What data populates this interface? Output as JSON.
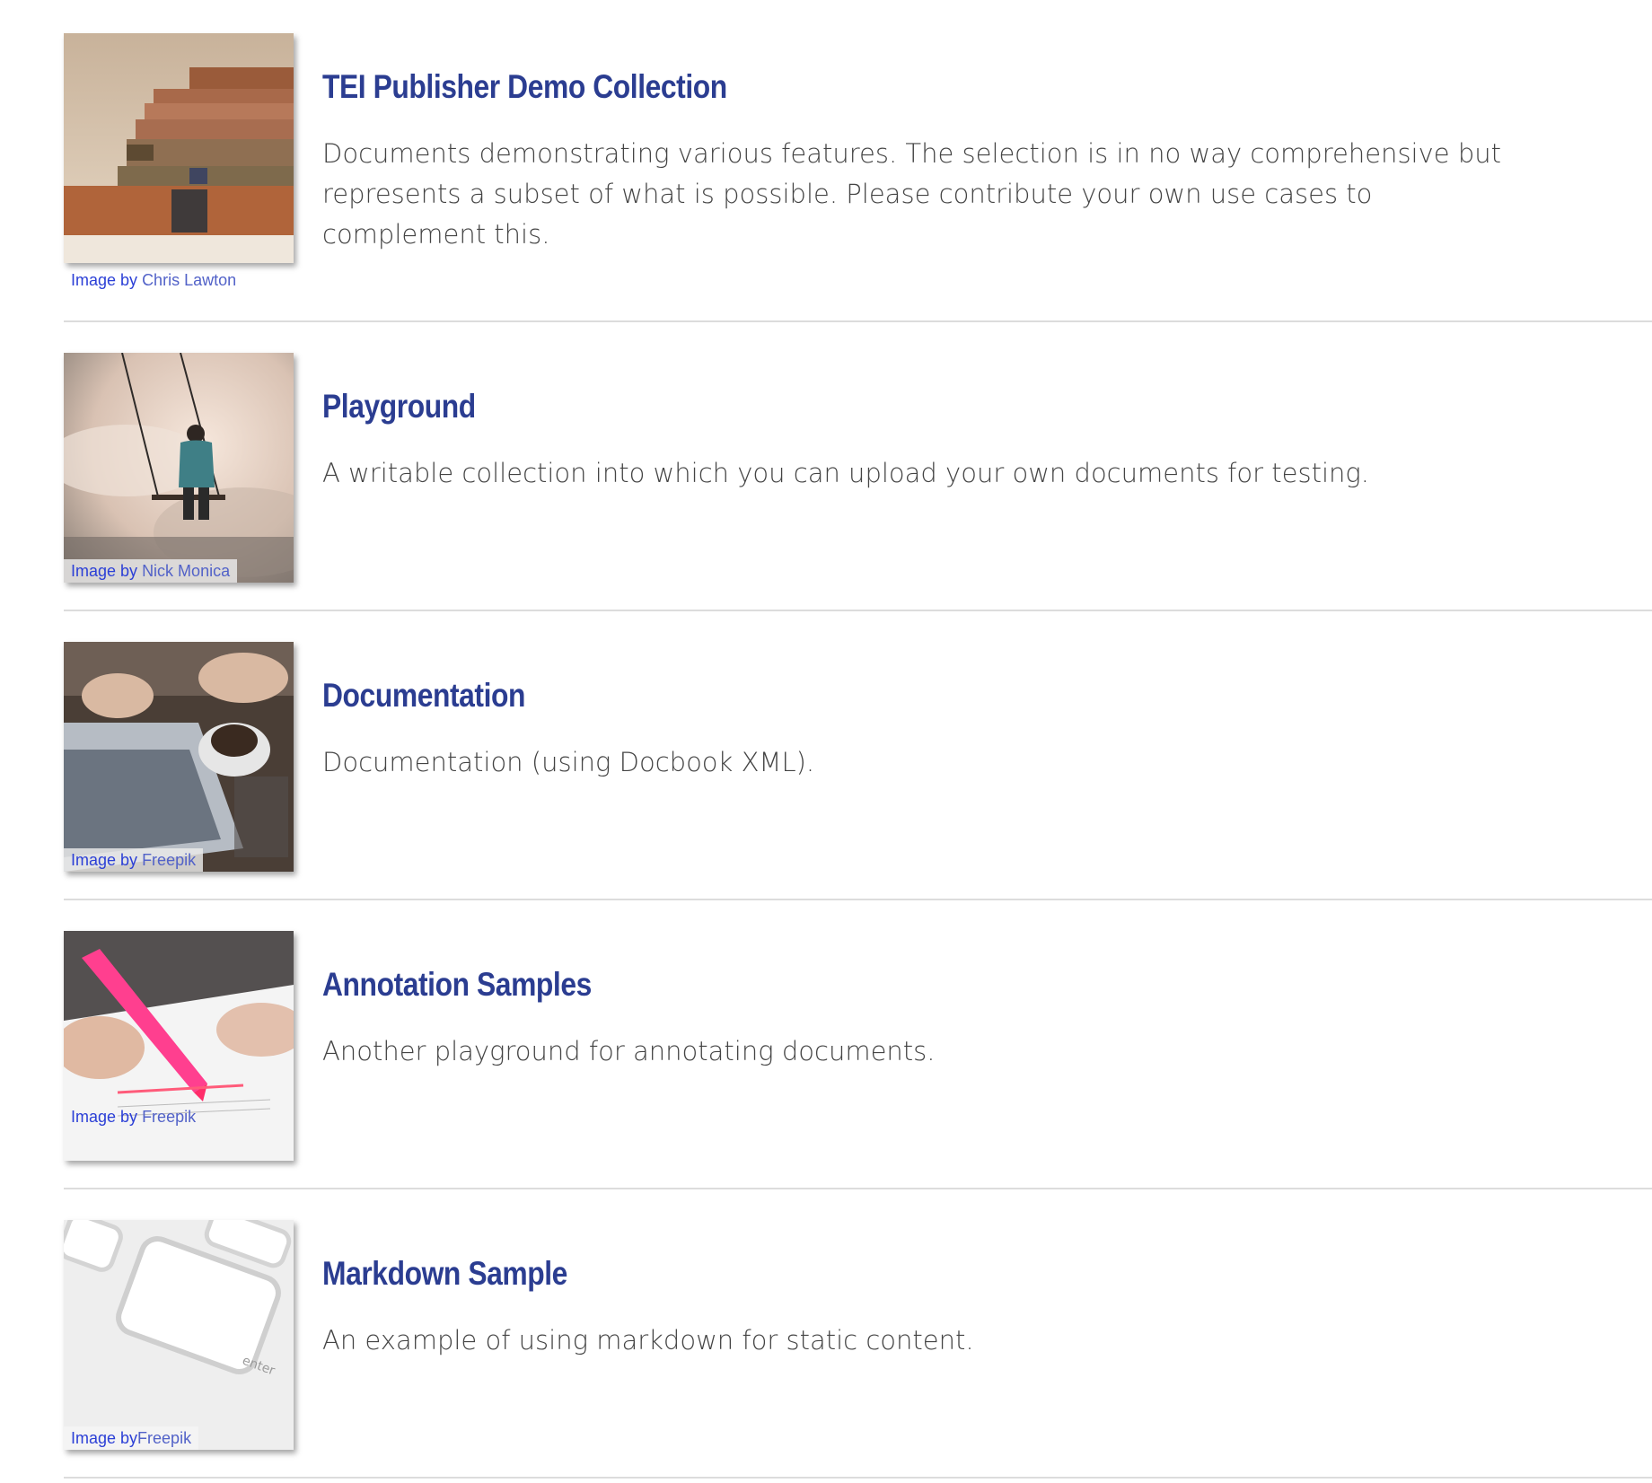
{
  "collections": [
    {
      "title": "TEI Publisher Demo Collection",
      "description": "Documents demonstrating various features. The selection is in no way comprehensive but represents a subset of what is possible. Please contribute your own use cases to complement this.",
      "credit_prefix": "Image by",
      "credit_author": "Chris Lawton",
      "image": "old-books-stack"
    },
    {
      "title": "Playground",
      "description": "A writable collection into which you can upload your own documents for testing.",
      "credit_prefix": "Image by",
      "credit_author": "Nick Monica",
      "image": "girl-on-swing-in-clouds"
    },
    {
      "title": "Documentation",
      "description": "Documentation (using Docbook XML).",
      "credit_prefix": "Image by",
      "credit_author": "Freepik",
      "image": "laptop-and-coffee"
    },
    {
      "title": "Annotation Samples",
      "description": "Another playground for annotating documents.",
      "credit_prefix": "Image by",
      "credit_author": "Freepik",
      "image": "highlighter-on-paper"
    },
    {
      "title": "Markdown Sample",
      "description": "An example of using markdown for static content.",
      "credit_prefix": "Image by",
      "credit_author": "Freepik",
      "image": "keyboard-enter-key"
    }
  ],
  "colors": {
    "title": "#2b3d91",
    "credit_link": "#3a4fd1",
    "description": "#444444",
    "divider": "#dcdcdc"
  }
}
